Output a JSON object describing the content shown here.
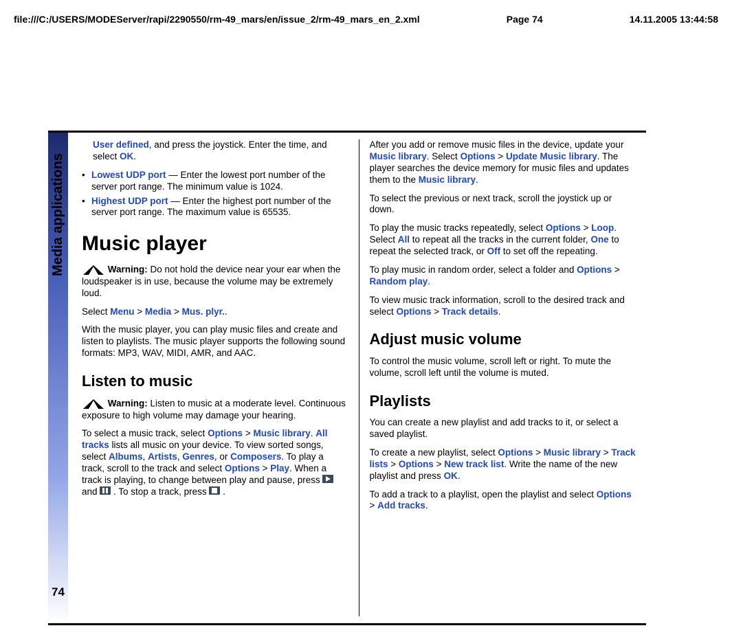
{
  "header": {
    "path": "file:///C:/USERS/MODEServer/rapi/2290550/rm-49_mars/en/issue_2/rm-49_mars_en_2.xml",
    "page_label": "Page 74",
    "datetime": "14.11.2005 13:44:58"
  },
  "sidebar": {
    "section_title": "Media applications",
    "page_number": "74"
  },
  "col1": {
    "intro_user_defined": "User defined",
    "intro_after1": ", and press the joystick. Enter the time, and select ",
    "intro_ok": "OK",
    "intro_after2": ".",
    "b1_label": "Lowest UDP port",
    "b1_text": " — Enter the lowest port number of the server port range. The minimum value is 1024.",
    "b2_label": "Highest UDP port",
    "b2_text": " — Enter the highest port number of the server port range. The maximum value is 65535.",
    "h_music_player": "Music player",
    "warn1_label": "Warning:",
    "warn1_text": "  Do not hold the device near your ear when the loudspeaker is in use, because the volume may be extremely loud.",
    "sel1_pre": "Select ",
    "sel1_menu": "Menu",
    "sel1_gt1": " > ",
    "sel1_media": "Media",
    "sel1_gt2": " > ",
    "sel1_mus": "Mus. plyr.",
    "sel1_end": ".",
    "desc1": "With the music player, you can play music files and create and listen to playlists. The music player supports the following sound formats: MP3, WAV, MIDI, AMR, and AAC.",
    "h_listen": "Listen to music",
    "warn2_label": "Warning:",
    "warn2_text": "  Listen to music at a moderate level. Continuous exposure to high volume may damage your hearing.",
    "p3_pre": "To select a music track, select ",
    "p3_opt": "Options",
    "p3_gt": " > ",
    "p3_ml": "Music library",
    "p3_dot": ". ",
    "p3_all": "All tracks",
    "p3_after_all": " lists all music on your device. To view sorted songs, select ",
    "p3_albums": "Albums",
    "p3_c1": ", ",
    "p3_artists": "Artists",
    "p3_c2": ", ",
    "p3_genres": "Genres",
    "p3_c3": ", or ",
    "p3_composers": "Composers",
    "p3_after_comp": ". To play a track, scroll to the track and select ",
    "p3_opt2": "Options",
    "p3_gt2": " > ",
    "p3_play": "Play",
    "p3_after_play": ". When a track is playing, to change between play and pause, press ",
    "p3_and": " and ",
    "p3_after_pause": " . To stop a track, press ",
    "p3_end": " ."
  },
  "col2": {
    "p1_pre": "After you add or remove music files in the device, update your ",
    "p1_ml": "Music library",
    "p1_mid": ". Select ",
    "p1_opt": "Options",
    "p1_gt": " > ",
    "p1_upd": "Update Music library",
    "p1_after": ". The player searches the device memory for music files and updates them to the ",
    "p1_ml2": "Music library",
    "p1_end": ".",
    "p2": "To select the previous or next track, scroll the joystick up or down.",
    "p3_pre": "To play the music tracks repeatedly, select ",
    "p3_opt": "Options",
    "p3_gt": " > ",
    "p3_loop": "Loop",
    "p3_mid": ". Select ",
    "p3_all": "All",
    "p3_after_all": " to repeat all the tracks in the current folder, ",
    "p3_one": "One",
    "p3_after_one": " to repeat the selected track, or ",
    "p3_off": "Off",
    "p3_end": " to set off the repeating.",
    "p4_pre": "To play music in random order, select a folder and ",
    "p4_opt": "Options",
    "p4_gt": " > ",
    "p4_rand": "Random play",
    "p4_end": ".",
    "p5_pre": "To view music track information, scroll to the desired track and select ",
    "p5_opt": "Options",
    "p5_gt": " > ",
    "p5_det": "Track details",
    "p5_end": ".",
    "h_volume": "Adjust music volume",
    "p6": "To control the music volume, scroll left or right. To mute the volume, scroll left until the volume is muted.",
    "h_playlists": "Playlists",
    "p7": "You can create a new playlist and add tracks to it, or select a saved playlist.",
    "p8_pre": "To create a new playlist, select ",
    "p8_opt": "Options",
    "p8_gt1": " > ",
    "p8_ml": "Music library",
    "p8_gt2": " > ",
    "p8_tl": "Track lists",
    "p8_gt3": " > ",
    "p8_opt2": "Options",
    "p8_gt4": " > ",
    "p8_ntl": "New track list",
    "p8_after": ". Write the name of the new playlist and press ",
    "p8_ok": "OK",
    "p8_end": ".",
    "p9_pre": "To add a track to a playlist, open the playlist and select ",
    "p9_opt": "Options",
    "p9_gt": " > ",
    "p9_add": "Add tracks",
    "p9_end": "."
  }
}
